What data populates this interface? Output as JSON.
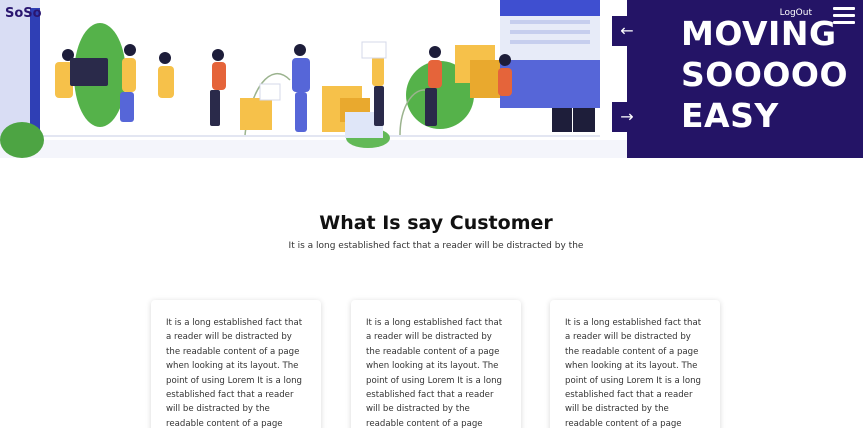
{
  "header": {
    "brand": "SoSo",
    "logout_label": "LogOut",
    "menu_icon": "hamburger-icon"
  },
  "hero": {
    "title_lines": [
      "MOVING",
      "SOOOOO",
      "EASY"
    ],
    "prev_arrow": "←",
    "next_arrow": "→",
    "panel_color": "#241466"
  },
  "testimonials": {
    "title": "What Is say Customer",
    "subtitle": "It is a long established fact that a reader will be distracted by the",
    "cards": [
      {
        "text": "It is a long established fact that a reader will be distracted by the readable content of a page when looking at its layout. The point of using Lorem It is a long established fact that a reader will be distracted by the readable content of a page"
      },
      {
        "text": "It is a long established fact that a reader will be distracted by the readable content of a page when looking at its layout. The point of using Lorem It is a long established fact that a reader will be distracted by the readable content of a page"
      },
      {
        "text": "It is a long established fact that a reader will be distracted by the readable content of a page when looking at its layout. The point of using Lorem It is a long established fact that a reader will be distracted by the readable content of a page"
      }
    ]
  }
}
